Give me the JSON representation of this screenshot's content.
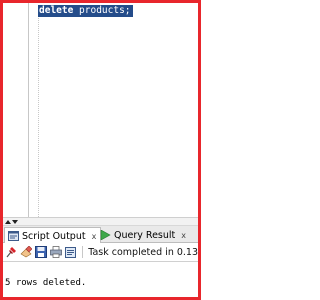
{
  "editor": {
    "code_keyword": "delete",
    "code_rest": " products;"
  },
  "panel": {
    "tabs": [
      {
        "label": "Script Output",
        "close": "x",
        "active": true,
        "icon": "script-output-icon"
      },
      {
        "label": "Query Result",
        "close": "x",
        "active": false,
        "icon": "run-arrow-icon"
      }
    ],
    "toolbar": {
      "buttons": [
        "pin-icon",
        "eraser-icon",
        "save-icon",
        "print-icon",
        "export-icon"
      ],
      "status": "Task completed in 0.13"
    },
    "output_text": "5 rows deleted."
  },
  "colors": {
    "frame_border": "#e8262c",
    "selection_bg": "#244c8a",
    "run_arrow": "#3ea84a"
  }
}
